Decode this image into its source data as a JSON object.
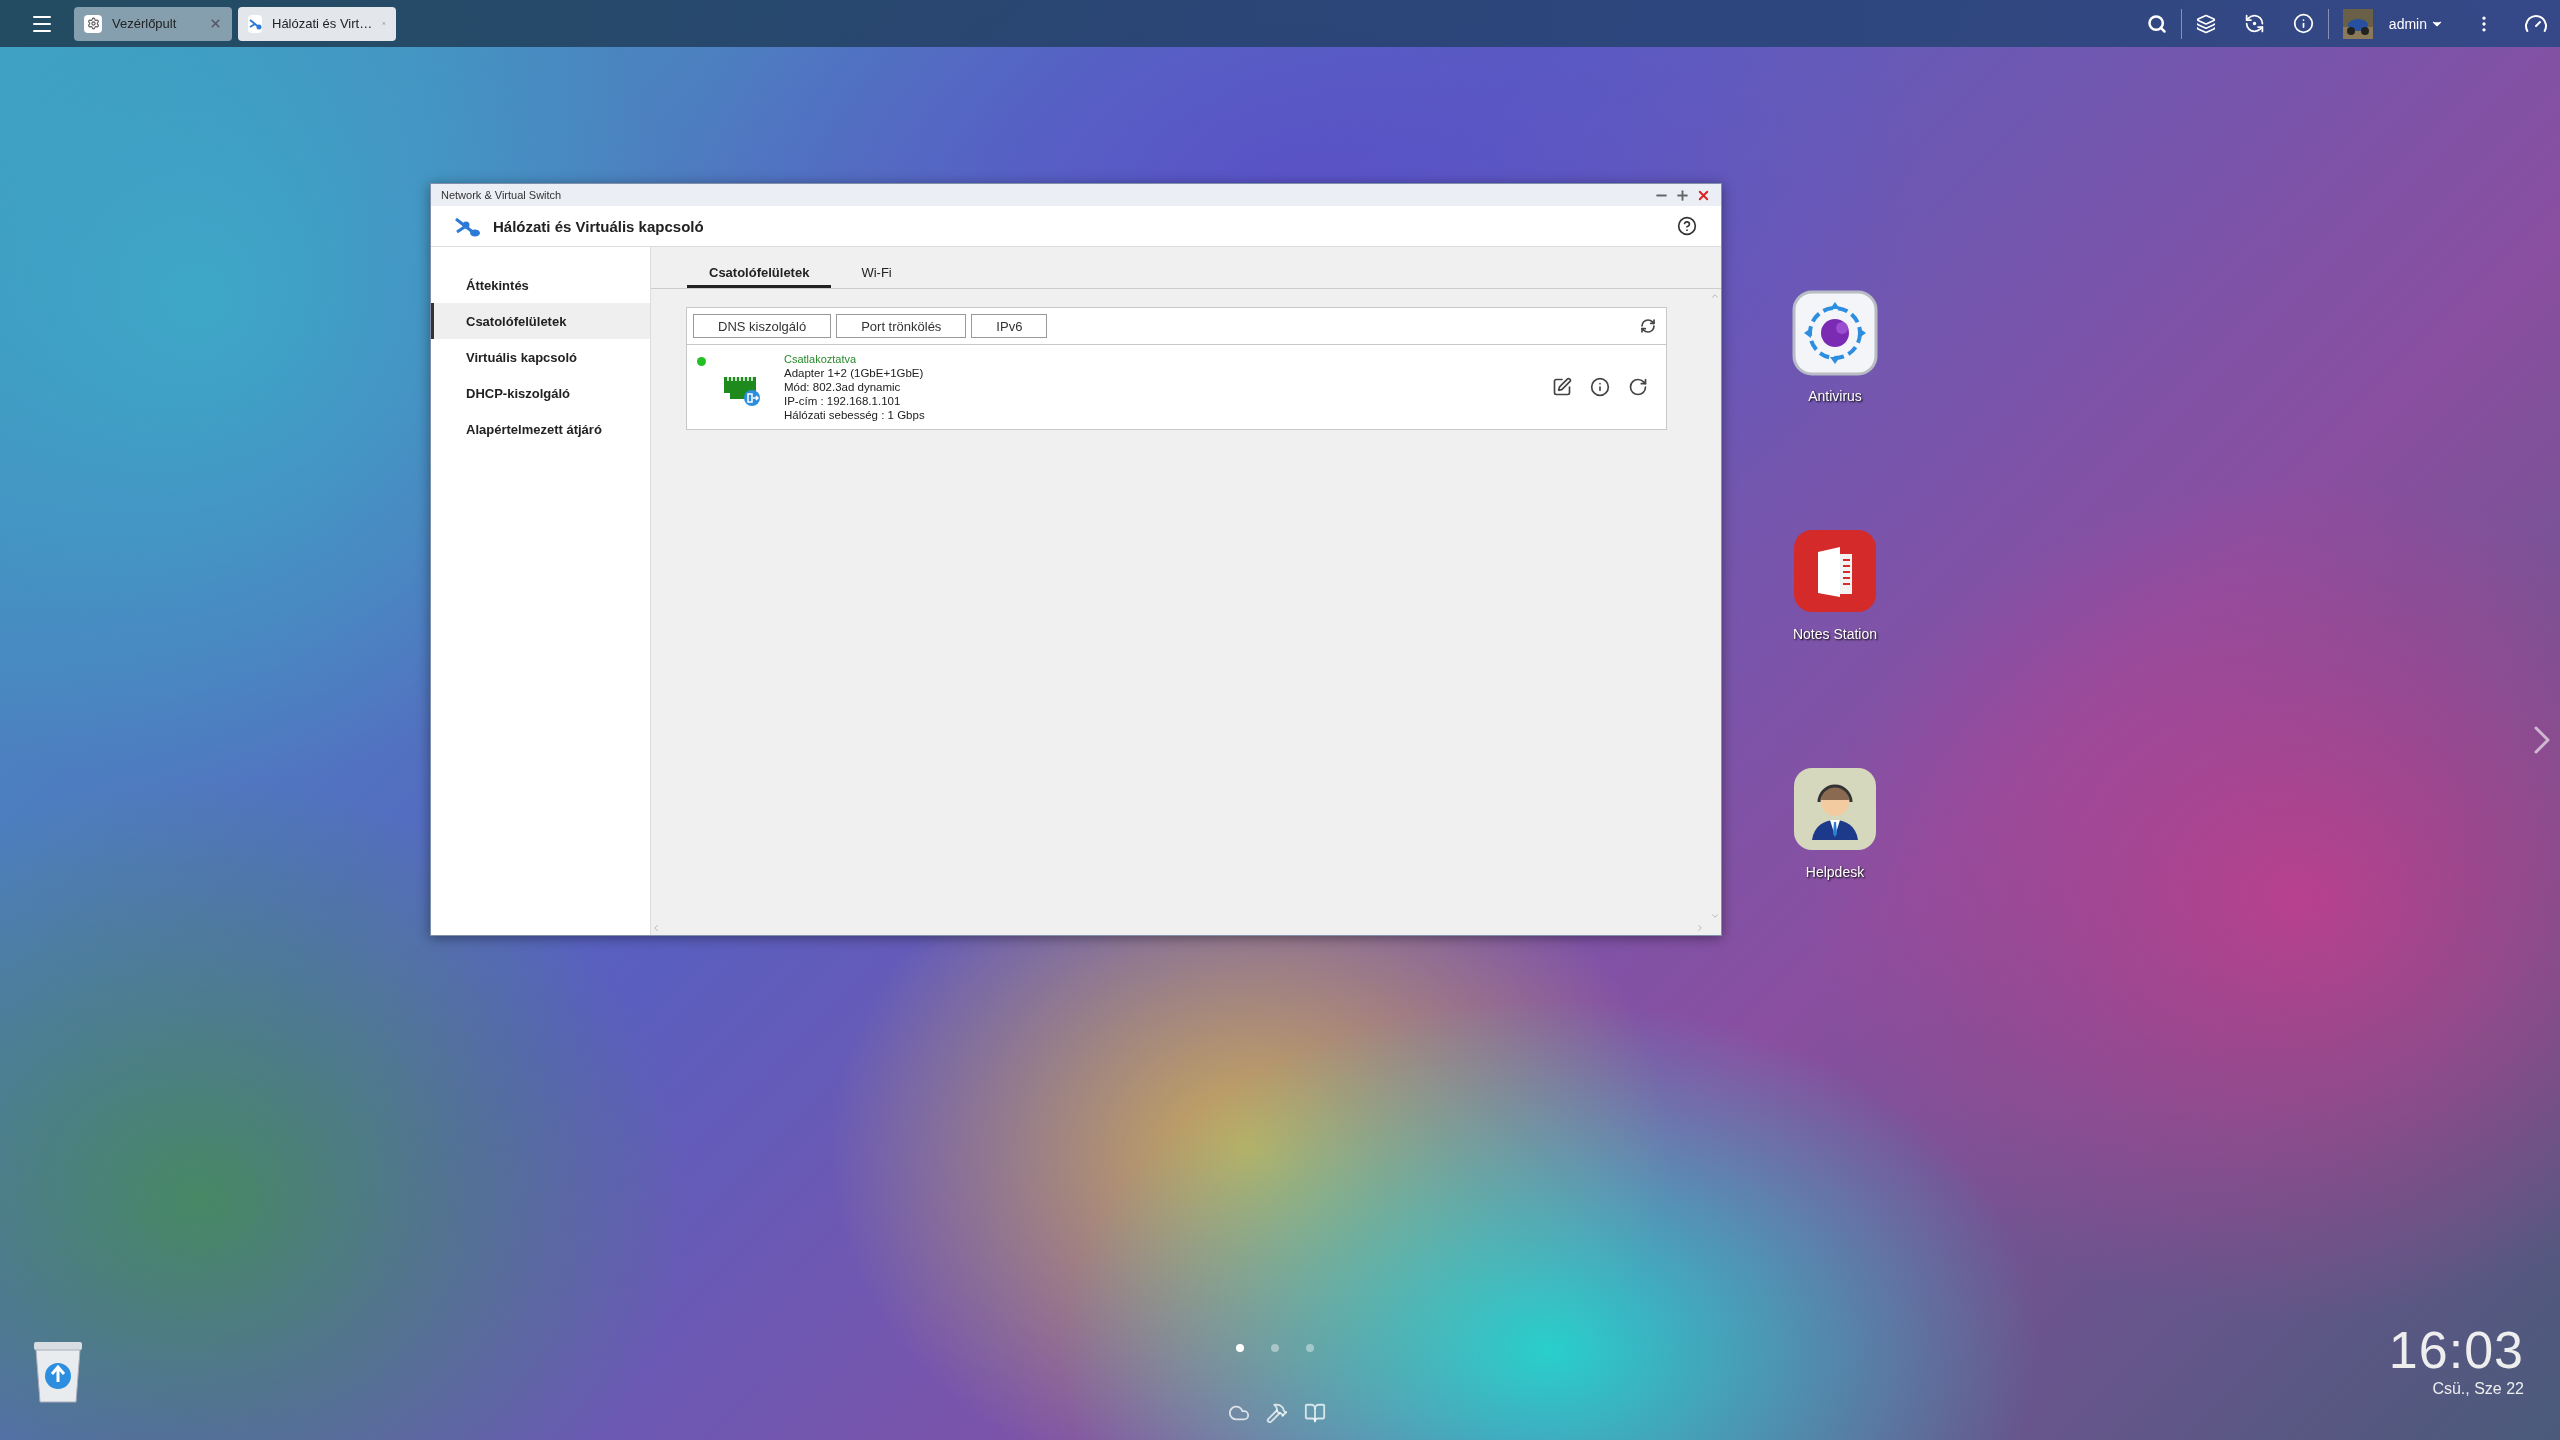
{
  "taskbar": {
    "tabs": [
      {
        "label": "Vezérlőpult",
        "kind": "settings",
        "selected": false
      },
      {
        "label": "Hálózati és Virt…",
        "kind": "network",
        "selected": true
      }
    ],
    "user": "admin"
  },
  "window": {
    "title": "Network & Virtual Switch",
    "app_title": "Hálózati és Virtuális kapcsoló",
    "sidebar": [
      {
        "label": "Áttekintés",
        "selected": false
      },
      {
        "label": "Csatolófelületek",
        "selected": true
      },
      {
        "label": "Virtuális kapcsoló",
        "selected": false
      },
      {
        "label": "DHCP-kiszolgáló",
        "selected": false
      },
      {
        "label": "Alapértelmezett átjáró",
        "selected": false
      }
    ],
    "tabs": [
      {
        "label": "Csatolófelületek",
        "selected": true
      },
      {
        "label": "Wi-Fi",
        "selected": false
      }
    ],
    "toolbar_buttons": [
      "DNS kiszolgáló",
      "Port trönkölés",
      "IPv6"
    ],
    "interfaces": [
      {
        "status": "Csatlakoztatva",
        "connected": true,
        "lines": [
          "Adapter 1+2 (1GbE+1GbE)",
          "Mód: 802.3ad dynamic",
          "IP-cím : 192.168.1.101",
          "Hálózati sebesség : 1 Gbps"
        ]
      }
    ]
  },
  "desktop_icons": [
    {
      "label": "Antivirus",
      "kind": "antivirus"
    },
    {
      "label": "Notes Station",
      "kind": "notes"
    },
    {
      "label": "Helpdesk",
      "kind": "helpdesk"
    }
  ],
  "pages": [
    {
      "selected": true
    },
    {
      "selected": false
    },
    {
      "selected": false
    }
  ],
  "clock": {
    "time": "16:03",
    "date": "Csü., Sze 22"
  }
}
